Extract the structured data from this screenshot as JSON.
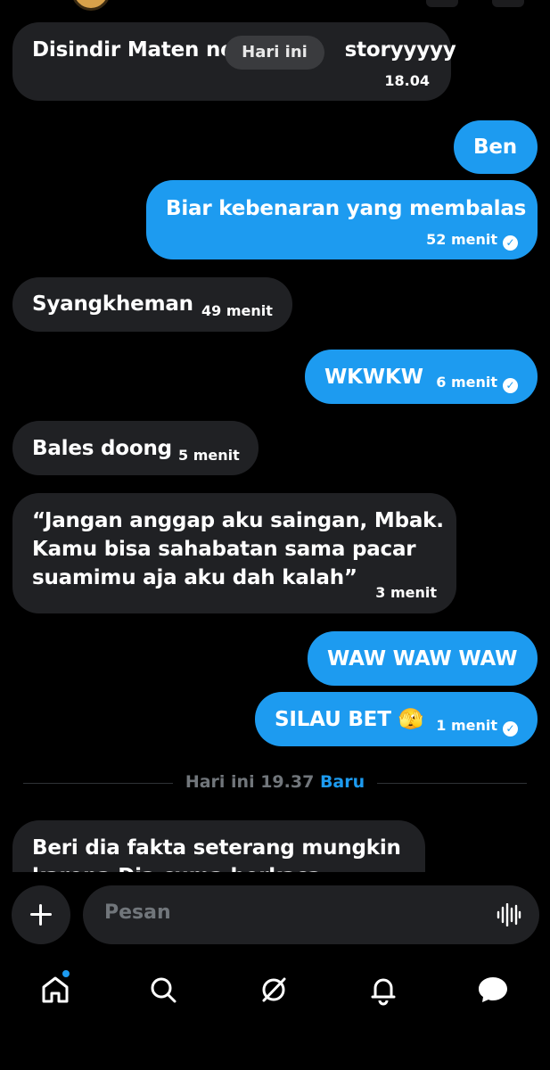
{
  "day_pill": "Hari ini",
  "messages": [
    {
      "text": "Disindir Maten ne",
      "text2": "storyyyyy",
      "time": "18.04"
    },
    {
      "text": "Ben"
    },
    {
      "text": "Biar kebenaran yang membalas",
      "time": "52 menit"
    },
    {
      "text": "Syangkheman",
      "time": "49 menit"
    },
    {
      "text": "WKWKW",
      "time": "6 menit"
    },
    {
      "text": "Bales doong",
      "time": "5 menit"
    },
    {
      "lines": [
        "“Jangan anggap aku saingan, Mbak.",
        "Kamu bisa sahabatan sama pacar",
        "suamimu aja aku dah kalah”"
      ],
      "time": "3 menit"
    },
    {
      "text": "WAW WAW WAW"
    },
    {
      "text": "SILAU BET",
      "emoji": "🫣",
      "time": "1 menit"
    },
    {
      "lines": [
        "Beri dia fakta seterang mungkin",
        "karena Dia cuma berkaca"
      ]
    }
  ],
  "divider": {
    "label": "Hari ini 19.37",
    "new_label": "Baru"
  },
  "composer": {
    "placeholder": "Pesan",
    "add_icon": "plus-icon",
    "voice_icon": "waveform-icon"
  },
  "nav": [
    "home-icon",
    "search-icon",
    "grok-icon",
    "bell-icon",
    "messages-icon"
  ],
  "colors": {
    "accent": "#1d9bf0",
    "incoming_bubble": "#202124",
    "background": "#000000",
    "muted": "#71767b"
  }
}
